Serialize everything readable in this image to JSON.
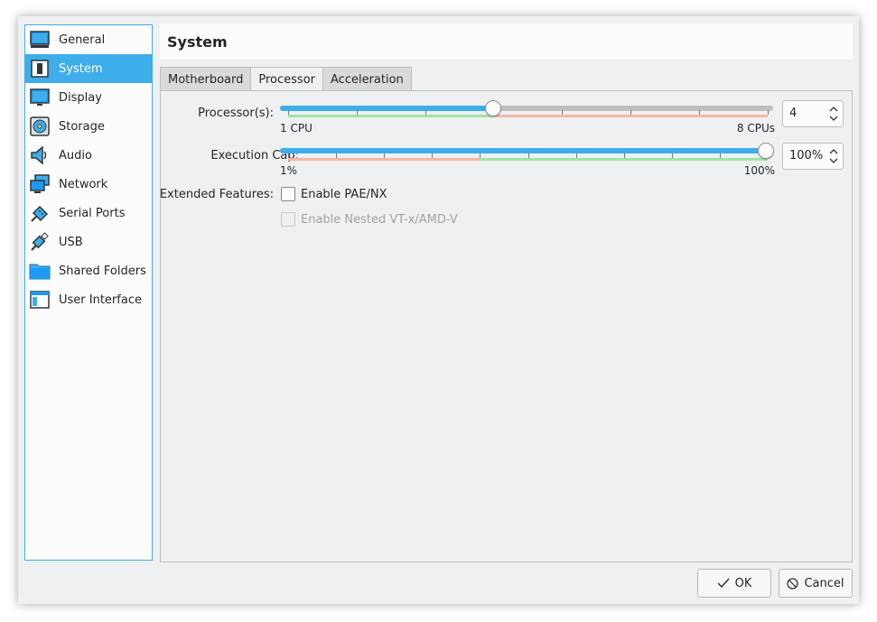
{
  "sidebar": {
    "items": [
      {
        "label": "General",
        "icon": "monitor-icon"
      },
      {
        "label": "System",
        "icon": "chip-icon"
      },
      {
        "label": "Display",
        "icon": "display-icon"
      },
      {
        "label": "Storage",
        "icon": "disk-icon"
      },
      {
        "label": "Audio",
        "icon": "speaker-icon"
      },
      {
        "label": "Network",
        "icon": "network-icon"
      },
      {
        "label": "Serial Ports",
        "icon": "serial-port-icon"
      },
      {
        "label": "USB",
        "icon": "usb-icon"
      },
      {
        "label": "Shared Folders",
        "icon": "folder-icon"
      },
      {
        "label": "User Interface",
        "icon": "window-icon"
      }
    ],
    "selected": "System"
  },
  "header": {
    "title": "System"
  },
  "tabs": [
    {
      "label": "Motherboard"
    },
    {
      "label": "Processor"
    },
    {
      "label": "Acceleration"
    }
  ],
  "active_tab": "Processor",
  "processor": {
    "label": "Processor(s):",
    "min_label": "1 CPU",
    "max_label": "8 CPUs",
    "value": "4",
    "level": 0.43
  },
  "exec_cap": {
    "label": "Execution Cap:",
    "min_label": "1%",
    "max_label": "100%",
    "value": "100%",
    "level": 1.0
  },
  "extended": {
    "label": "Extended Features:",
    "pae_label": "Enable PAE/NX",
    "pae_checked": false,
    "nested_label": "Enable Nested VT-x/AMD-V",
    "nested_checked": false,
    "nested_enabled": false
  },
  "buttons": {
    "ok": "OK",
    "cancel": "Cancel"
  },
  "colors": {
    "accent": "#3daee9",
    "safe_zone": "#9fe6a0",
    "warn_zone": "#f5b7a6"
  }
}
